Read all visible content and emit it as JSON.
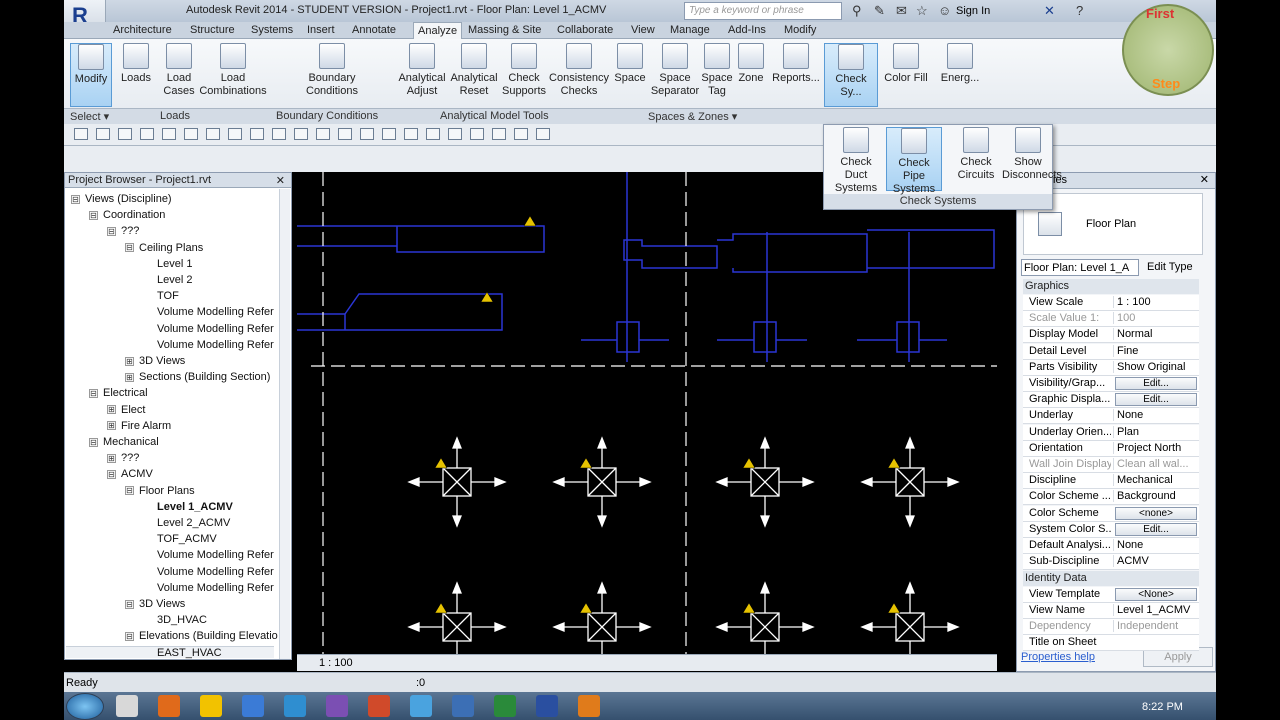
{
  "window": {
    "app_letter": "R",
    "title": "Autodesk Revit 2014 -  STUDENT VERSION -    Project1.rvt - Floor Plan: Level 1_ACMV",
    "search_placeholder": "Type a keyword or phrase",
    "sign_in": "Sign In"
  },
  "tabs": [
    "Architecture",
    "Structure",
    "Systems",
    "Insert",
    "Annotate",
    "Analyze",
    "Massing & Site",
    "Collaborate",
    "View",
    "Manage",
    "Add-Ins",
    "Modify"
  ],
  "active_tab": "Analyze",
  "ribbon": {
    "buttons": [
      {
        "label": "Modify"
      },
      {
        "label": "Loads"
      },
      {
        "label": "Load\nCases"
      },
      {
        "label": "Load\nCombinations"
      },
      {
        "label": "Boundary\nConditions"
      },
      {
        "label": "Analytical\nAdjust"
      },
      {
        "label": "Analytical\nReset"
      },
      {
        "label": "Check\nSupports"
      },
      {
        "label": "Consistency\nChecks"
      },
      {
        "label": "Space"
      },
      {
        "label": "Space\nSeparator"
      },
      {
        "label": "Space\nTag"
      },
      {
        "label": "Zone"
      },
      {
        "label": "Reports..."
      },
      {
        "label": "Check Sy..."
      },
      {
        "label": "Color Fill"
      },
      {
        "label": "Energ..."
      }
    ],
    "panels": [
      "Select ▾",
      "Loads",
      "Boundary Conditions",
      "Analytical Model Tools",
      "Spaces & Zones ▾"
    ]
  },
  "check_systems_menu": {
    "items": [
      {
        "label": "Check Duct\nSystems"
      },
      {
        "label": "Check Pipe\nSystems"
      },
      {
        "label": "Check\nCircuits"
      },
      {
        "label": "Show\nDisconnects"
      }
    ],
    "footer": "Check Systems"
  },
  "project_browser": {
    "title": "Project Browser - Project1.rvt",
    "close": "✕",
    "tree": [
      {
        "label": "Views (Discipline)",
        "depth": 0,
        "tw": "⊟"
      },
      {
        "label": "Coordination",
        "depth": 1,
        "tw": "⊟"
      },
      {
        "label": "???",
        "depth": 2,
        "tw": "⊟"
      },
      {
        "label": "Ceiling Plans",
        "depth": 3,
        "tw": "⊟"
      },
      {
        "label": "Level 1",
        "depth": 4
      },
      {
        "label": "Level 2",
        "depth": 4
      },
      {
        "label": "TOF",
        "depth": 4
      },
      {
        "label": "Volume Modelling Refer",
        "depth": 4
      },
      {
        "label": "Volume Modelling Refer",
        "depth": 4
      },
      {
        "label": "Volume Modelling Refer",
        "depth": 4
      },
      {
        "label": "3D Views",
        "depth": 3,
        "tw": "⊞"
      },
      {
        "label": "Sections (Building Section)",
        "depth": 3,
        "tw": "⊞"
      },
      {
        "label": "Electrical",
        "depth": 1,
        "tw": "⊟"
      },
      {
        "label": "Elect",
        "depth": 2,
        "tw": "⊞"
      },
      {
        "label": "Fire Alarm",
        "depth": 2,
        "tw": "⊞"
      },
      {
        "label": "Mechanical",
        "depth": 1,
        "tw": "⊟"
      },
      {
        "label": "???",
        "depth": 2,
        "tw": "⊞"
      },
      {
        "label": "ACMV",
        "depth": 2,
        "tw": "⊟"
      },
      {
        "label": "Floor Plans",
        "depth": 3,
        "tw": "⊟"
      },
      {
        "label": "Level 1_ACMV",
        "depth": 4,
        "bold": true
      },
      {
        "label": "Level 2_ACMV",
        "depth": 4
      },
      {
        "label": "TOF_ACMV",
        "depth": 4
      },
      {
        "label": "Volume Modelling Refer",
        "depth": 4
      },
      {
        "label": "Volume Modelling Refer",
        "depth": 4
      },
      {
        "label": "Volume Modelling Refer",
        "depth": 4
      },
      {
        "label": "3D Views",
        "depth": 3,
        "tw": "⊟"
      },
      {
        "label": "3D_HVAC",
        "depth": 4
      },
      {
        "label": "Elevations (Building Elevatio",
        "depth": 3,
        "tw": "⊟"
      },
      {
        "label": "EAST_HVAC",
        "depth": 4
      }
    ]
  },
  "properties": {
    "title_partial": "ies",
    "type_name": "Floor Plan",
    "instance_selector": "Floor Plan: Level 1_A",
    "edit_type": "Edit Type",
    "categories": {
      "graphics": "Graphics",
      "identity": "Identity Data"
    },
    "rows": [
      {
        "k": "View Scale",
        "v": "1 : 100"
      },
      {
        "k": "Scale Value    1:",
        "v": "100",
        "dim": true
      },
      {
        "k": "Display Model",
        "v": "Normal"
      },
      {
        "k": "Detail Level",
        "v": "Fine"
      },
      {
        "k": "Parts Visibility",
        "v": "Show Original"
      },
      {
        "k": "Visibility/Grap...",
        "btn": "Edit..."
      },
      {
        "k": "Graphic Displa...",
        "btn": "Edit..."
      },
      {
        "k": "Underlay",
        "v": "None"
      },
      {
        "k": "Underlay Orien...",
        "v": "Plan"
      },
      {
        "k": "Orientation",
        "v": "Project North"
      },
      {
        "k": "Wall Join Display",
        "v": "Clean all wal...",
        "dim": true
      },
      {
        "k": "Discipline",
        "v": "Mechanical"
      },
      {
        "k": "Color Scheme ...",
        "v": "Background"
      },
      {
        "k": "Color Scheme",
        "btn": "<none>"
      },
      {
        "k": "System Color S...",
        "btn": "Edit..."
      },
      {
        "k": "Default Analysi...",
        "v": "None"
      },
      {
        "k": "Sub-Discipline",
        "v": "ACMV"
      },
      {
        "cat": "identity"
      },
      {
        "k": "View Template",
        "btn": "<None>"
      },
      {
        "k": "View Name",
        "v": "Level 1_ACMV"
      },
      {
        "k": "Dependency",
        "v": "Independent",
        "dim": true
      },
      {
        "k": "Title on Sheet",
        "v": ""
      }
    ],
    "help_link": "Properties help",
    "apply": "Apply"
  },
  "view_control": {
    "scale": "1 : 100"
  },
  "status": {
    "text": "Ready",
    "filter_count": ":0"
  },
  "taskbar": {
    "time": "8:22 PM"
  },
  "overlay_badge": {
    "line1": "First",
    "line2": "Step"
  },
  "colors": {
    "canvas_bg": "#000000",
    "duct": "#2a35d4",
    "fixture": "#ffffff",
    "warning": "#e6c200",
    "accent_sel": "#a9d2f3"
  }
}
